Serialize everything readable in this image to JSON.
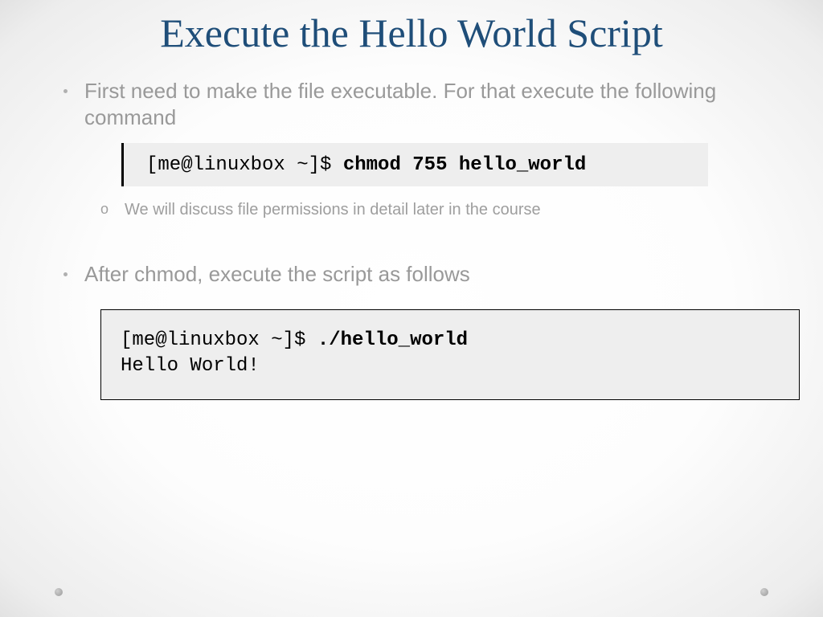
{
  "title": "Execute the Hello World Script",
  "bullets": {
    "first": "First need to make the file executable. For that execute the following command",
    "sub_o_marker": "o",
    "sub_note": "We will discuss file permissions in detail later in the course",
    "second": "After chmod, execute the script as follows"
  },
  "terminal1": {
    "prompt": "[me@linuxbox ~]$ ",
    "command": "chmod 755 hello_world"
  },
  "terminal2": {
    "prompt": "[me@linuxbox ~]$ ",
    "command": "./hello_world",
    "output": "Hello World!"
  }
}
